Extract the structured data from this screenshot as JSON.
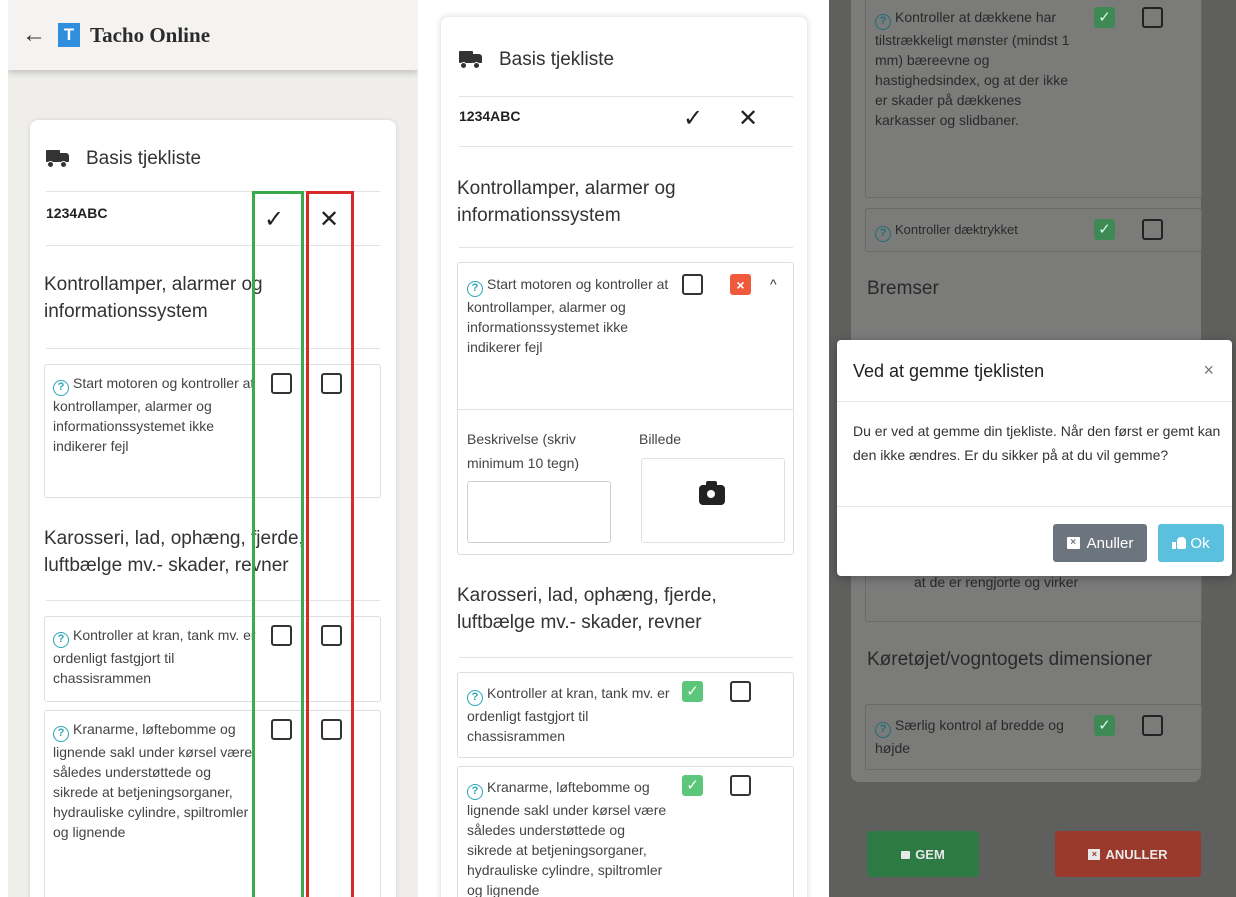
{
  "header": {
    "back_glyph": "←",
    "logo_letter": "T",
    "app_title": "Tacho Online"
  },
  "checklist": {
    "title": "Basis tjekliste",
    "plate": "1234ABC",
    "ok_glyph": "✓",
    "fail_glyph": "✕",
    "sections": [
      {
        "title": "Kontrollamper, alarmer og informationssystem"
      },
      {
        "title": "Karosseri, lad, ophæng, fjerde, luftbælge mv.- skader, revner"
      },
      {
        "title": "Bremser"
      },
      {
        "title": "Køretøjet/vogntogets dimensioner"
      }
    ],
    "items": {
      "motor": "Start motoren og kontroller at kontrollamper, alarmer og informationssystemet ikke indikerer fejl",
      "kran": "Kontroller at kran, tank mv. er ordenligt fastgjort til chassisrammen",
      "kranarme": "Kranarme, løftebomme og lignende sakl under kørsel være således understøttede og sikrede at betjeningsorganer, hydrauliske cylindre, spiltromler og lignende",
      "daek_moenster": "Kontroller at dækkene har tilstrækkeligt mønster (mindst 1 mm) bæreevne og hastighedsindex, og at der ikke er skader på dækkenes karkasser og slidbaner.",
      "daektryk": "Kontroller dæktrykket",
      "rengjort": "at de er rengjorte og virker",
      "bredde": "Særlig kontrol af bredde og højde"
    },
    "description_label": "Beskrivelse (skriv minimum 10 tegn)",
    "description_value": "",
    "image_label": "Billede"
  },
  "icons": {
    "question": "?",
    "check": "✓",
    "cross": "×",
    "caret_up": "^"
  },
  "bottom_buttons": {
    "save": "GEM",
    "cancel": "ANULLER"
  },
  "modal": {
    "title": "Ved at gemme tjeklisten",
    "close_glyph": "×",
    "body": "Du er ved at gemme din tjekliste. Når den først er gemt kan den ikke ændres. Er du sikker på at du vil gemme?",
    "cancel_label": "Anuller",
    "cancel_icon_glyph": "×",
    "ok_label": "Ok"
  },
  "colors": {
    "brand": "#2f8fdd",
    "ok_green": "#5cc77a",
    "fail_red": "#f05a3c",
    "highlight_green": "#3aaa4a",
    "highlight_red": "#d92a2a",
    "info": "#5bc0de",
    "secondary": "#6c757d"
  }
}
